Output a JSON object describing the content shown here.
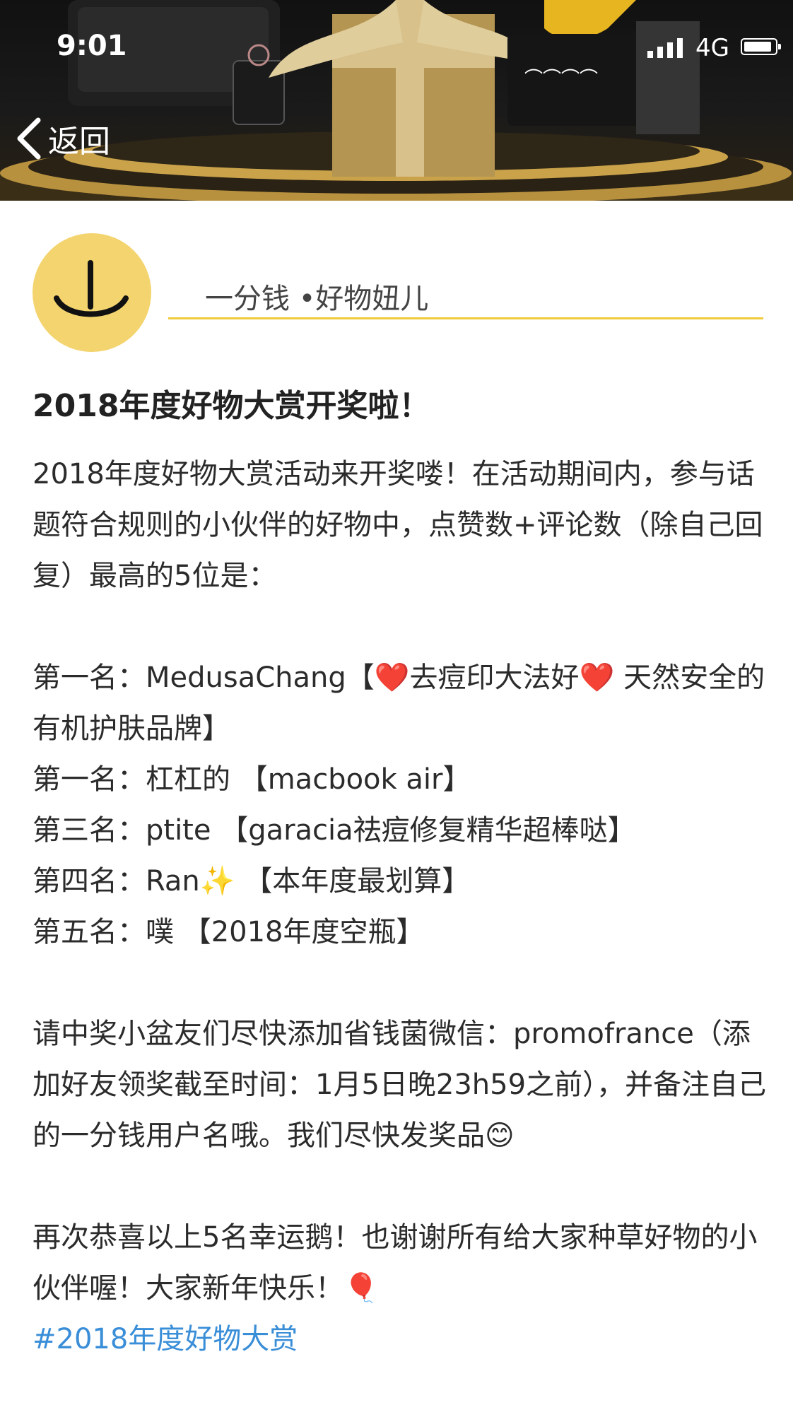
{
  "status_bar": {
    "time": "9:01",
    "network": "4G"
  },
  "nav": {
    "back_label": "返回"
  },
  "author": {
    "name": "一分钱 •好物妞儿"
  },
  "post": {
    "title": "2018年度好物大赏开奖啦！",
    "intro": "2018年度好物大赏活动来开奖喽！在活动期间内，参与话题符合规则的小伙伴的好物中，点赞数+评论数（除自己回复）最高的5位是：",
    "winners": [
      "第一名：MedusaChang【❤️去痘印大法好❤️ 天然安全的有机护肤品牌】",
      "第一名：杠杠的 【macbook air】",
      "第三名：ptite 【garacia祛痘修复精华超棒哒】",
      "第四名：Ran✨ 【本年度最划算】",
      "第五名：噗 【2018年度空瓶】"
    ],
    "instructions": "请中奖小盆友们尽快添加省钱菌微信：promofrance（添加好友领奖截至时间：1月5日晚23h59之前），并备注自己的一分钱用户名哦。我们尽快发奖品😊",
    "closing": "再次恭喜以上5名幸运鹅！也谢谢所有给大家种草好物的小伙伴喔！大家新年快乐！🎈",
    "hashtag": "#2018年度好物大赏"
  }
}
